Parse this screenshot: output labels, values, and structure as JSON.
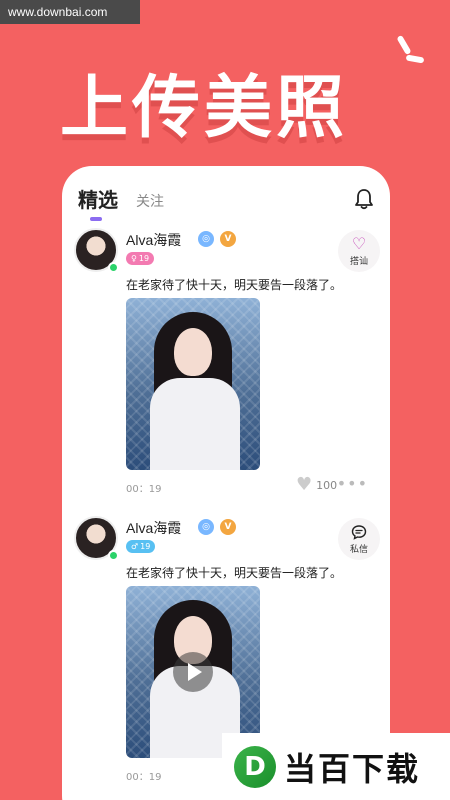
{
  "watermark": "www.downbai.com",
  "headline": "上传美照",
  "tabs": {
    "active": "精选",
    "other": "关注"
  },
  "posts": [
    {
      "name": "Alva海霞",
      "age": "19",
      "gender": "female",
      "action_label": "搭讪",
      "action_icon": "♡",
      "caption": "在老家待了快十天，明天要告一段落了。",
      "time": "00：19",
      "likes": "100",
      "has_video": false
    },
    {
      "name": "Alva海霞",
      "age": "19",
      "gender": "male",
      "action_label": "私信",
      "action_icon": "💬",
      "caption": "在老家待了快十天，明天要告一段落了。",
      "time": "00：19",
      "has_video": true
    }
  ],
  "badges": {
    "v1": "◎",
    "v2": "V"
  },
  "gender_icons": {
    "female": "♀",
    "male": "♂"
  },
  "brand": {
    "logo": "D",
    "text": "当百下载"
  },
  "colors": {
    "background": "#f46161",
    "accent": "#8b6cf0",
    "online": "#2bd36a"
  }
}
